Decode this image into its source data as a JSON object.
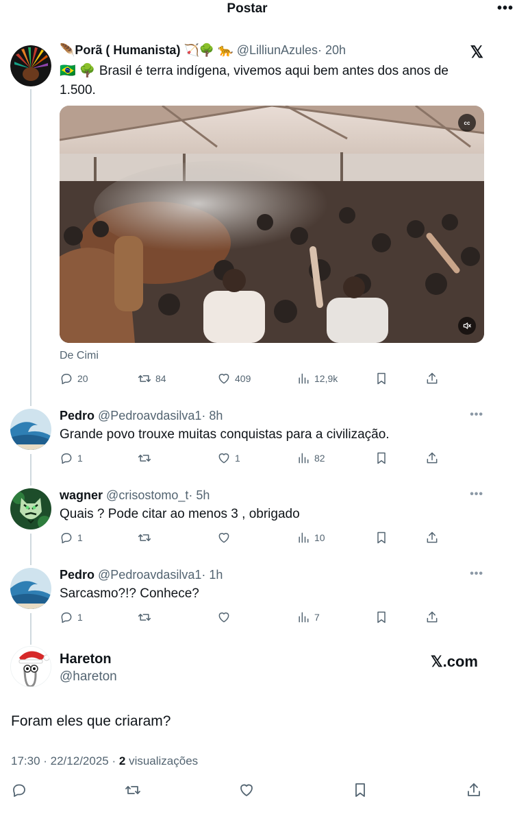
{
  "header": {
    "title": "Postar",
    "more": "•••"
  },
  "main_post": {
    "name": "🪶Porã ( Humanista) 🏹🌳 🐆",
    "handle": "@LilliunAzules",
    "time": "· 20h",
    "text_line1": "🇧🇷 🌳 Brasil é terra indígena, vivemos aqui bem antes dos anos de",
    "text_line2": "1.500.",
    "video_cc": "cc",
    "source": "De Cimi",
    "stats": {
      "replies": "20",
      "reposts": "84",
      "likes": "409",
      "views": "12,9k"
    }
  },
  "replies": [
    {
      "name": "Pedro",
      "handle": "@Pedroavdasilva1",
      "time": "· 8h",
      "text": "Grande povo trouxe muitas conquistas para a civilização.",
      "stats": {
        "replies": "1",
        "reposts": "",
        "likes": "1",
        "views": "82"
      }
    },
    {
      "name": "wagner",
      "handle": "@crisostomo_t",
      "time": "· 5h",
      "text": "Quais ? Pode citar ao menos 3 , obrigado",
      "stats": {
        "replies": "1",
        "reposts": "",
        "likes": "",
        "views": "10"
      }
    },
    {
      "name": "Pedro",
      "handle": "@Pedroavdasilva1",
      "time": "· 1h",
      "text": "Sarcasmo?!? Conhece?",
      "stats": {
        "replies": "1",
        "reposts": "",
        "likes": "",
        "views": "7"
      }
    }
  ],
  "quote": {
    "name": "Hareton",
    "handle": "@hareton",
    "brand": "𝕏.com",
    "text": "Foram eles que criaram?",
    "timestamp": "17:30 · 22/12/2025 ·",
    "view_count": "2",
    "view_label": "visualizações"
  },
  "icons": {
    "x_logo": "𝕏",
    "reply": "reply-icon",
    "repost": "repost-icon",
    "like": "heart-icon",
    "views": "views-icon",
    "bookmark": "bookmark-icon",
    "share": "share-icon"
  },
  "colors": {
    "text": "#0f1419",
    "secondary": "#536471",
    "thread": "#cfd9de"
  }
}
